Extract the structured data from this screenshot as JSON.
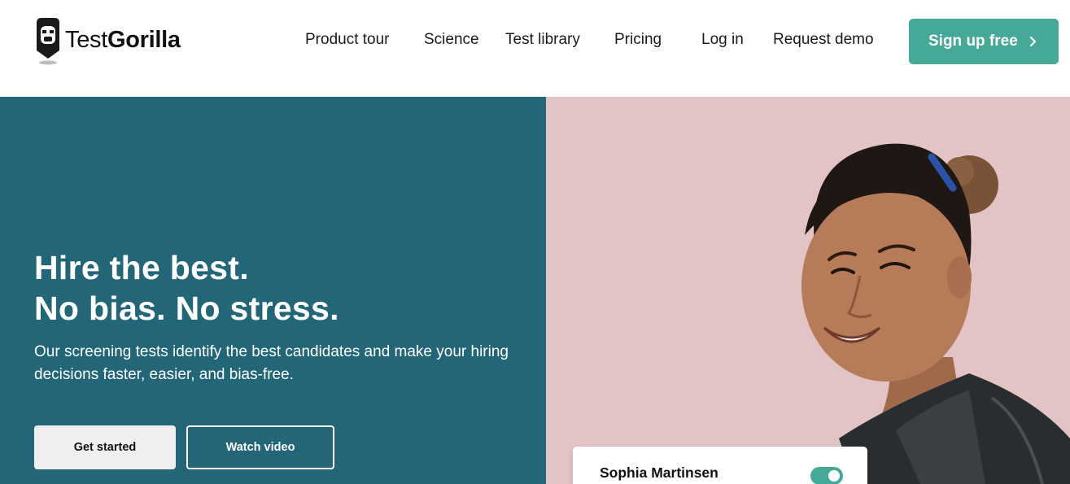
{
  "brand": {
    "logo_text_light": "Test",
    "logo_text_bold": "Gorilla",
    "logo_icon": "gorilla-head-pin-icon"
  },
  "nav": {
    "items": [
      {
        "label": "Product tour"
      },
      {
        "label": "Science"
      },
      {
        "label": "Test library"
      },
      {
        "label": "Pricing"
      },
      {
        "label": "Log in"
      },
      {
        "label": "Request demo"
      }
    ],
    "signup_label": "Sign up free",
    "signup_icon": "chevron-right-icon"
  },
  "hero": {
    "headline_line1": "Hire the best.",
    "headline_line2": "No bias. No stress.",
    "subtext": "Our screening tests identify the best candidates and make your hiring decisions faster, easier, and bias-free.",
    "primary_cta": "Get started",
    "secondary_cta": "Watch video",
    "image": "smiling-candidate-portrait"
  },
  "candidate_card": {
    "name": "Sophia Martinsen",
    "toggle_on": true
  },
  "colors": {
    "accent": "#46a997",
    "hero_left_bg": "#236677",
    "hero_right_bg": "#e2c3c6",
    "text_dark": "#1b1b1b"
  }
}
